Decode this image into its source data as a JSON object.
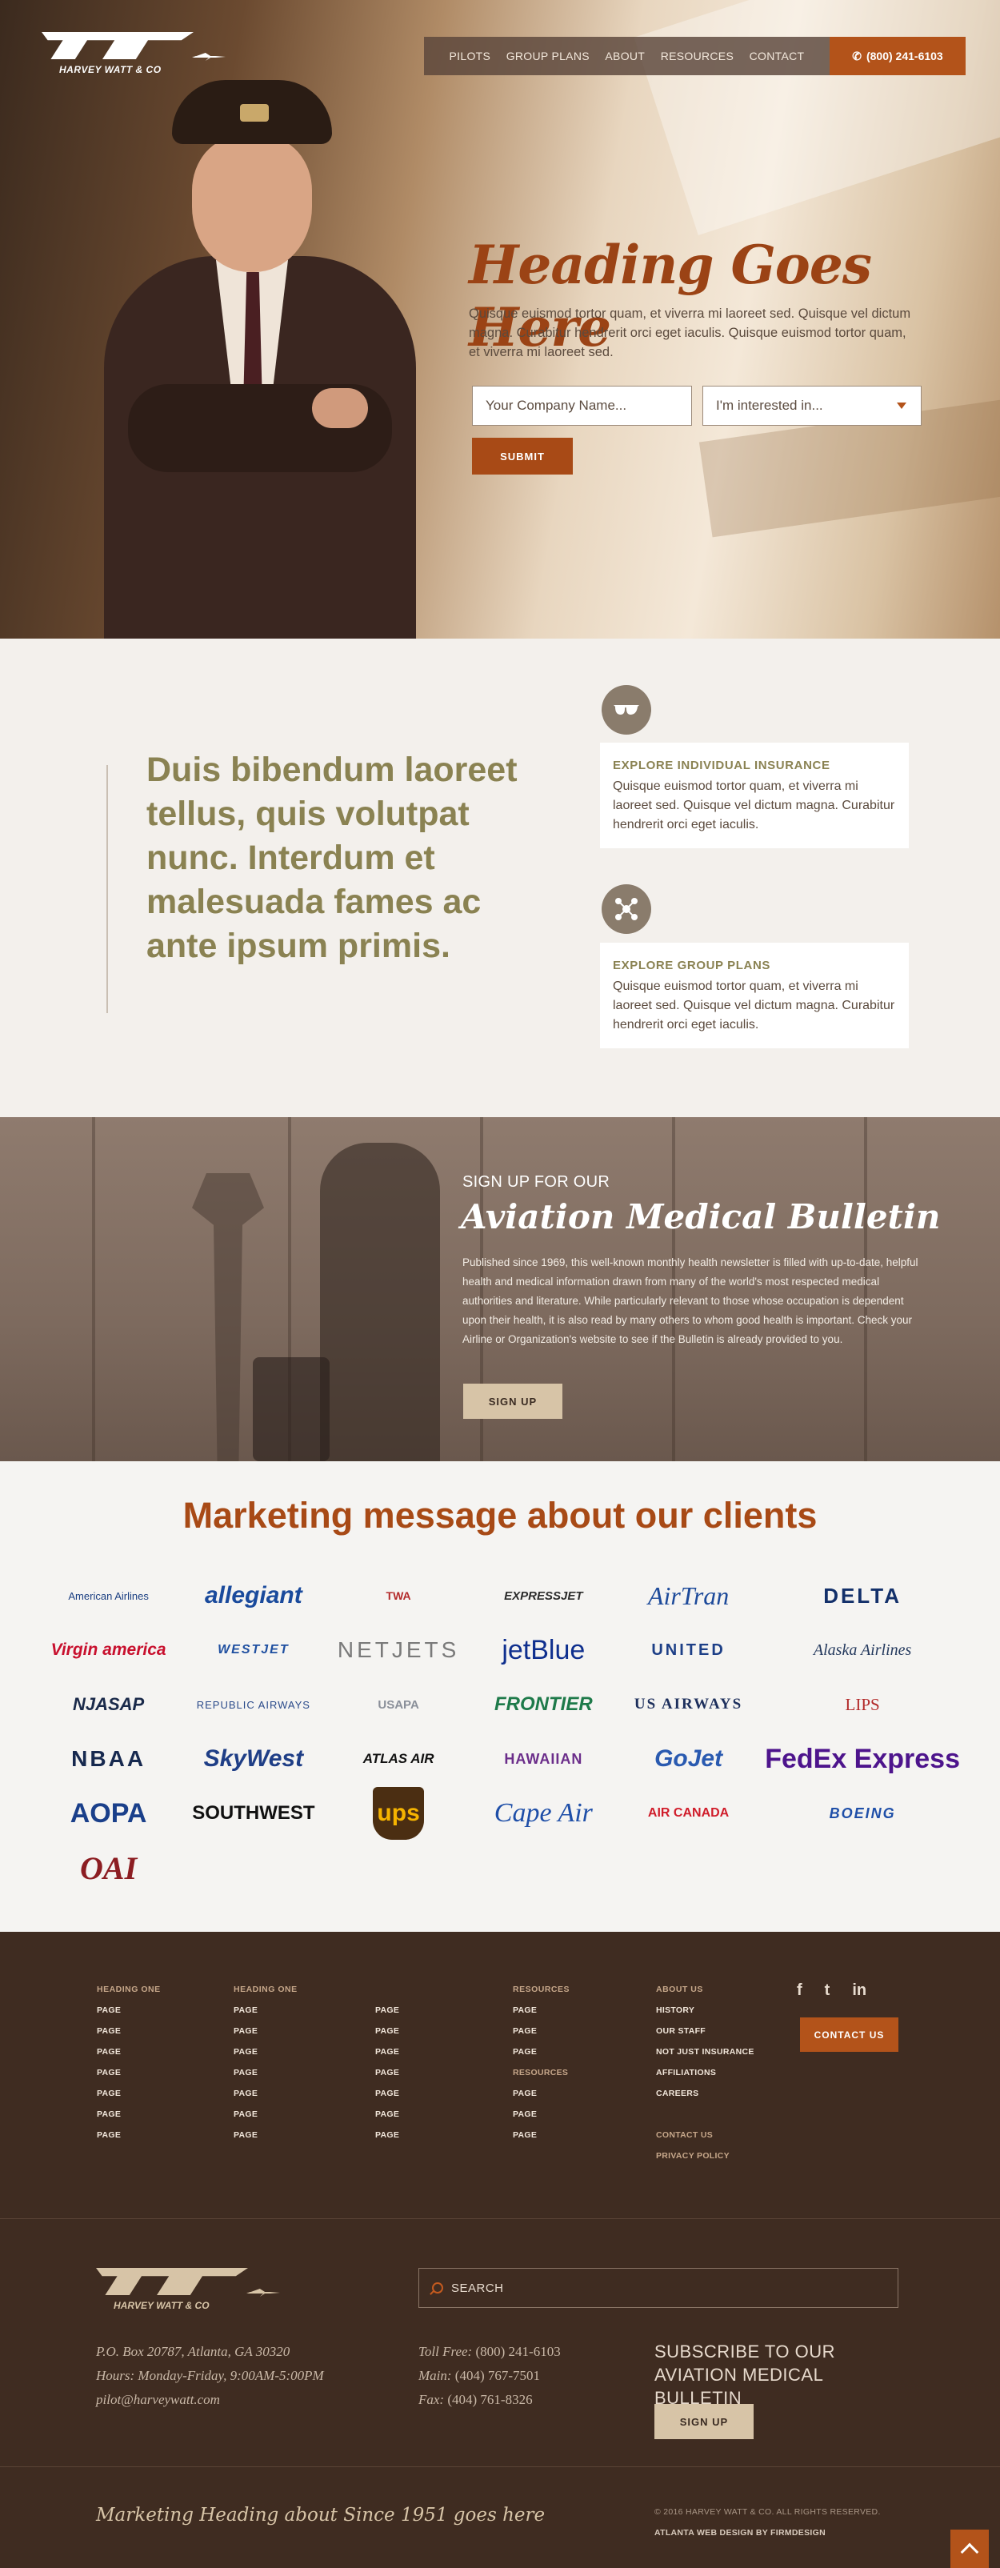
{
  "brand": {
    "name": "HARVEY WATT & CO"
  },
  "nav": {
    "items": [
      "PILOTS",
      "GROUP PLANS",
      "ABOUT",
      "RESOURCES",
      "CONTACT"
    ],
    "phone": "(800) 241-6103"
  },
  "hero": {
    "title": "Heading Goes Here",
    "text": "Quisque euismod tortor quam, et viverra mi laoreet sed. Quisque vel dictum magna. Curabitur hendrerit orci eget iaculis. Quisque euismod tortor quam, et viverra mi laoreet sed.",
    "company_placeholder": "Your Company Name...",
    "interest_select": "I'm interested in...",
    "submit": "SUBMIT"
  },
  "features": {
    "quote": "Duis bibendum laoreet tellus, quis volutpat nunc. Interdum et malesuada fames ac ante ipsum primis.",
    "cards": [
      {
        "title": "EXPLORE INDIVIDUAL INSURANCE",
        "text": "Quisque euismod tortor quam, et viverra mi laoreet sed. Quisque vel dictum magna. Curabitur hendrerit orci eget iaculis.",
        "icon": "sunglasses-icon"
      },
      {
        "title": "EXPLORE GROUP PLANS",
        "text": "Quisque euismod tortor quam, et viverra mi laoreet sed. Quisque vel dictum magna. Curabitur hendrerit orci eget iaculis.",
        "icon": "group-icon"
      }
    ]
  },
  "bulletin": {
    "kicker": "SIGN UP FOR OUR",
    "title": "Aviation Medical Bulletin",
    "body": "Published since 1969, this well-known monthly health newsletter is filled with up-to-date, helpful health and medical information drawn from many of the world's most respected medical authorities and literature. While particularly relevant to those whose occupation is dependent upon their health, it is also read by many others to whom good health is important.  Check your Airline or Organization's website to see if the Bulletin is already provided to you.",
    "button": "SIGN UP"
  },
  "clients": {
    "title": "Marketing message about our clients",
    "logos": [
      "American Airlines",
      "allegiant",
      "TWA",
      "EXPRESSJET",
      "AirTran",
      "DELTA",
      "Virgin america",
      "WESTJET",
      "NETJETS",
      "jetBlue",
      "UNITED",
      "Alaska Airlines",
      "NJASAP",
      "REPUBLIC AIRWAYS",
      "USAPA",
      "FRONTIER",
      "US AIRWAYS",
      "LIPS",
      "NBAA",
      "SkyWest",
      "ATLAS AIR",
      "HAWAIIAN",
      "GoJet",
      "FedEx Express",
      "AOPA",
      "SOUTHWEST",
      "ups",
      "Cape Air",
      "AIR CANADA",
      "OAI",
      "BOEING"
    ]
  },
  "footer": {
    "col1": {
      "heading": "HEADING ONE",
      "items": [
        "PAGE",
        "PAGE",
        "PAGE",
        "PAGE",
        "PAGE",
        "PAGE",
        "PAGE"
      ]
    },
    "col2": {
      "heading": "HEADING ONE",
      "items": [
        "PAGE",
        "PAGE",
        "PAGE",
        "PAGE",
        "PAGE",
        "PAGE",
        "PAGE"
      ]
    },
    "col3": {
      "items": [
        "PAGE",
        "PAGE",
        "PAGE",
        "PAGE",
        "PAGE",
        "PAGE",
        "PAGE"
      ]
    },
    "col4": {
      "heading": "RESOURCES",
      "items": [
        "PAGE",
        "PAGE",
        "PAGE",
        "RESOURCES",
        "PAGE",
        "PAGE",
        "PAGE"
      ]
    },
    "col5": {
      "heading": "ABOUT US",
      "items": [
        "HISTORY",
        "OUR STAFF",
        "NOT JUST INSURANCE",
        "AFFILIATIONS",
        "CAREERS",
        "",
        "CONTACT US",
        "PRIVACY POLICY"
      ]
    },
    "social": [
      "f",
      "t",
      "in"
    ],
    "contact_button": "CONTACT US",
    "search_label": "SEARCH",
    "address": [
      "P.O. Box 20787, Atlanta, GA 30320",
      "Hours: Monday-Friday, 9:00AM-5:00PM",
      "pilot@harveywatt.com"
    ],
    "phones": [
      {
        "label": "Toll Free:",
        "value": "(800) 241-6103"
      },
      {
        "label": "Main:",
        "value": "(404) 767-7501"
      },
      {
        "label": "Fax:",
        "value": "(404) 761-8326"
      }
    ],
    "subscribe": "SUBSCRIBE TO OUR AVIATION MEDICAL BULLETIN",
    "signup_button": "SIGN UP",
    "tagline": "Marketing Heading about Since 1951 goes here",
    "copyright": "© 2016 HARVEY WATT & CO. ALL RIGHTS RESERVED.",
    "credit": "ATLANTA WEB DESIGN BY FIRMDESIGN"
  },
  "colors": {
    "accent": "#b3531a",
    "olive": "#8a8252",
    "dark_footer": "#3f2c21",
    "tan": "#d7c4a7"
  }
}
